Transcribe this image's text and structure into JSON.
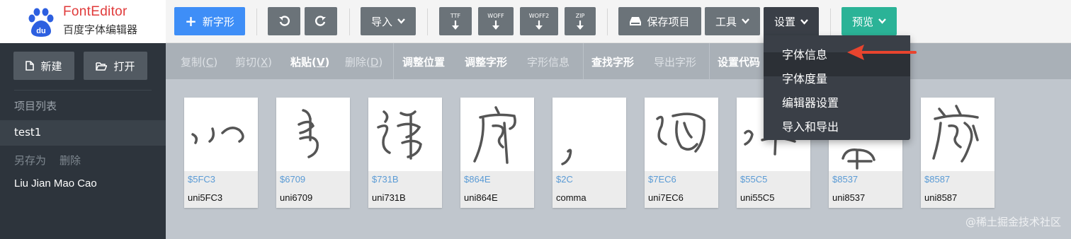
{
  "app": {
    "title": "FontEditor",
    "subtitle": "百度字体编辑器"
  },
  "toolbar": {
    "new_glyph": "新字形",
    "import": "导入",
    "formats": [
      "TTF",
      "WOFF",
      "WOFF2",
      "ZIP"
    ],
    "save": "保存项目",
    "tools": "工具",
    "settings": "设置",
    "preview": "预览"
  },
  "sidebar": {
    "new": "新建",
    "open": "打开",
    "project_list_header": "项目列表",
    "project": "test1",
    "save_as": "另存为",
    "delete": "删除",
    "font_name": "Liu Jian Mao Cao"
  },
  "edit_toolbar": {
    "copy": "复制(",
    "copy_key": "C",
    "copy_end": ")",
    "cut": "剪切(",
    "cut_key": "X",
    "cut_end": ")",
    "paste": "粘贴(",
    "paste_key": "V",
    "paste_end": ")",
    "delete": "删除(",
    "delete_key": "D",
    "delete_end": ")",
    "adjust_pos": "调整位置",
    "adjust_glyph": "调整字形",
    "glyph_info": "字形信息",
    "find_glyph": "查找字形",
    "export_glyph": "导出字形",
    "set_code": "设置代码"
  },
  "glyphs": [
    {
      "code": "$5FC3",
      "name": "uni5FC3"
    },
    {
      "code": "$6709",
      "name": "uni6709"
    },
    {
      "code": "$731B",
      "name": "uni731B"
    },
    {
      "code": "$864E",
      "name": "uni864E"
    },
    {
      "code": "$2C",
      "name": "comma"
    },
    {
      "code": "$7EC6",
      "name": "uni7EC6"
    },
    {
      "code": "$55C5",
      "name": "uni55C5"
    },
    {
      "code": "$8537",
      "name": "uni8537"
    },
    {
      "code": "$8587",
      "name": "uni8587"
    }
  ],
  "settings_menu": {
    "items": [
      "字体信息",
      "字体度量",
      "编辑器设置",
      "导入和导出"
    ]
  },
  "watermark": "@稀土掘金技术社区",
  "colors": {
    "accent_blue": "#3e8ef7",
    "preview_teal": "#2bb397",
    "annotation_arrow": "#e8442e",
    "code_blue": "#5b9bd5"
  }
}
